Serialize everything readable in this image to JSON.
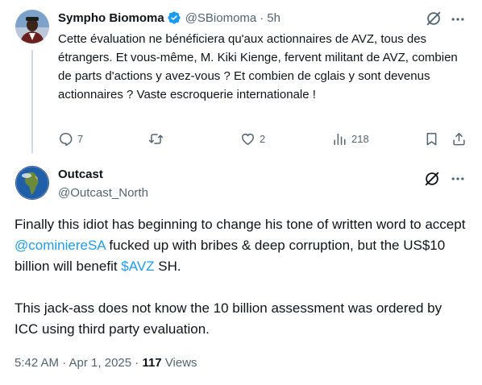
{
  "tweet1": {
    "author_name": "Sympho Biomoma",
    "handle": "@SBiomoma",
    "separator": "·",
    "time": "5h",
    "text": "Cette évaluation ne bénéficiera qu'aux actionnaires de AVZ, tous des étrangers. Et vous-même, M. Kiki Kienge, fervent militant de AVZ, combien de parts d'actions y avez-vous ? Et combien de cglais y sont devenus actionnaires ? Vaste escroquerie internationale !",
    "replies": "7",
    "retweets": "",
    "likes": "2",
    "views": "218"
  },
  "tweet2": {
    "author_name": "Outcast",
    "handle": "@Outcast_North",
    "para1_before": "Finally this idiot has beginning to change his tone of written word to accept ",
    "mention": "@cominiereSA",
    "para1_middle": " fucked up with bribes & deep corruption, but the US$10 billion will benefit ",
    "cashtag": "$AVZ",
    "para1_after": " SH.",
    "para2": "This jack-ass does not know the 10 billion assessment was ordered by ICC using third party evaluation.",
    "timestamp": "5:42 AM · Apr 1, 2025",
    "separator": " · ",
    "views_count": "117",
    "views_label": "Views"
  },
  "colors": {
    "text": "#0f1419",
    "secondary": "#536471",
    "link": "#1d9bf0",
    "verified": "#1d9bf0",
    "thread_line": "#cfd9de"
  },
  "icons": [
    "verified-badge-icon",
    "grok-icon",
    "more-icon",
    "reply-icon",
    "retweet-icon",
    "like-icon",
    "views-icon",
    "bookmark-icon",
    "share-icon"
  ]
}
